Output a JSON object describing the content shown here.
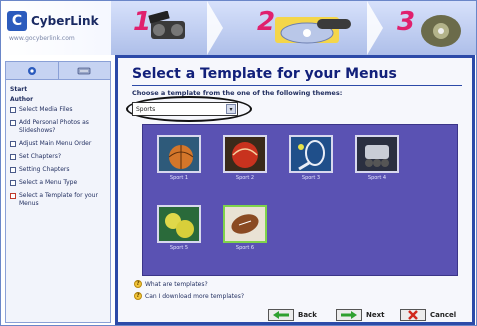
{
  "header": {
    "logo_text": "CyberLink",
    "logo_sub": "www.gocyberlink.com",
    "steps": [
      "1",
      "2",
      "3"
    ]
  },
  "left_panel": {
    "sections": [
      {
        "title": "Start",
        "items": []
      },
      {
        "title": "Author",
        "items": [
          {
            "label": "Select Media Files"
          },
          {
            "label": "Add Personal Photos as Slideshows?"
          },
          {
            "label": "Adjust Main Menu Order"
          },
          {
            "label": "Set Chapters?"
          },
          {
            "label": "Setting Chapters"
          },
          {
            "label": "Select a Menu Type"
          },
          {
            "label": "Select a Template for your Menus",
            "current": true
          }
        ]
      }
    ]
  },
  "main": {
    "title": "Select a Template for your Menus",
    "subtitle": "Choose a template from the one of the following themes:",
    "theme_select": {
      "value": "Sports"
    },
    "templates": [
      {
        "label": "Sport 1"
      },
      {
        "label": "Sport 2"
      },
      {
        "label": "Sport 3"
      },
      {
        "label": "Sport 4"
      },
      {
        "label": "Sport 5"
      },
      {
        "label": "Sport 6",
        "selected": true
      }
    ],
    "help_links": [
      "What are templates?",
      "Can I download more templates?"
    ],
    "buttons": {
      "back": "Back",
      "next": "Next",
      "cancel": "Cancel"
    }
  },
  "colors": {
    "accent": "#2c4aa8",
    "gallery_bg": "#5a52b3",
    "selected_border": "#7fd34b",
    "step_number": "#e0206d"
  }
}
